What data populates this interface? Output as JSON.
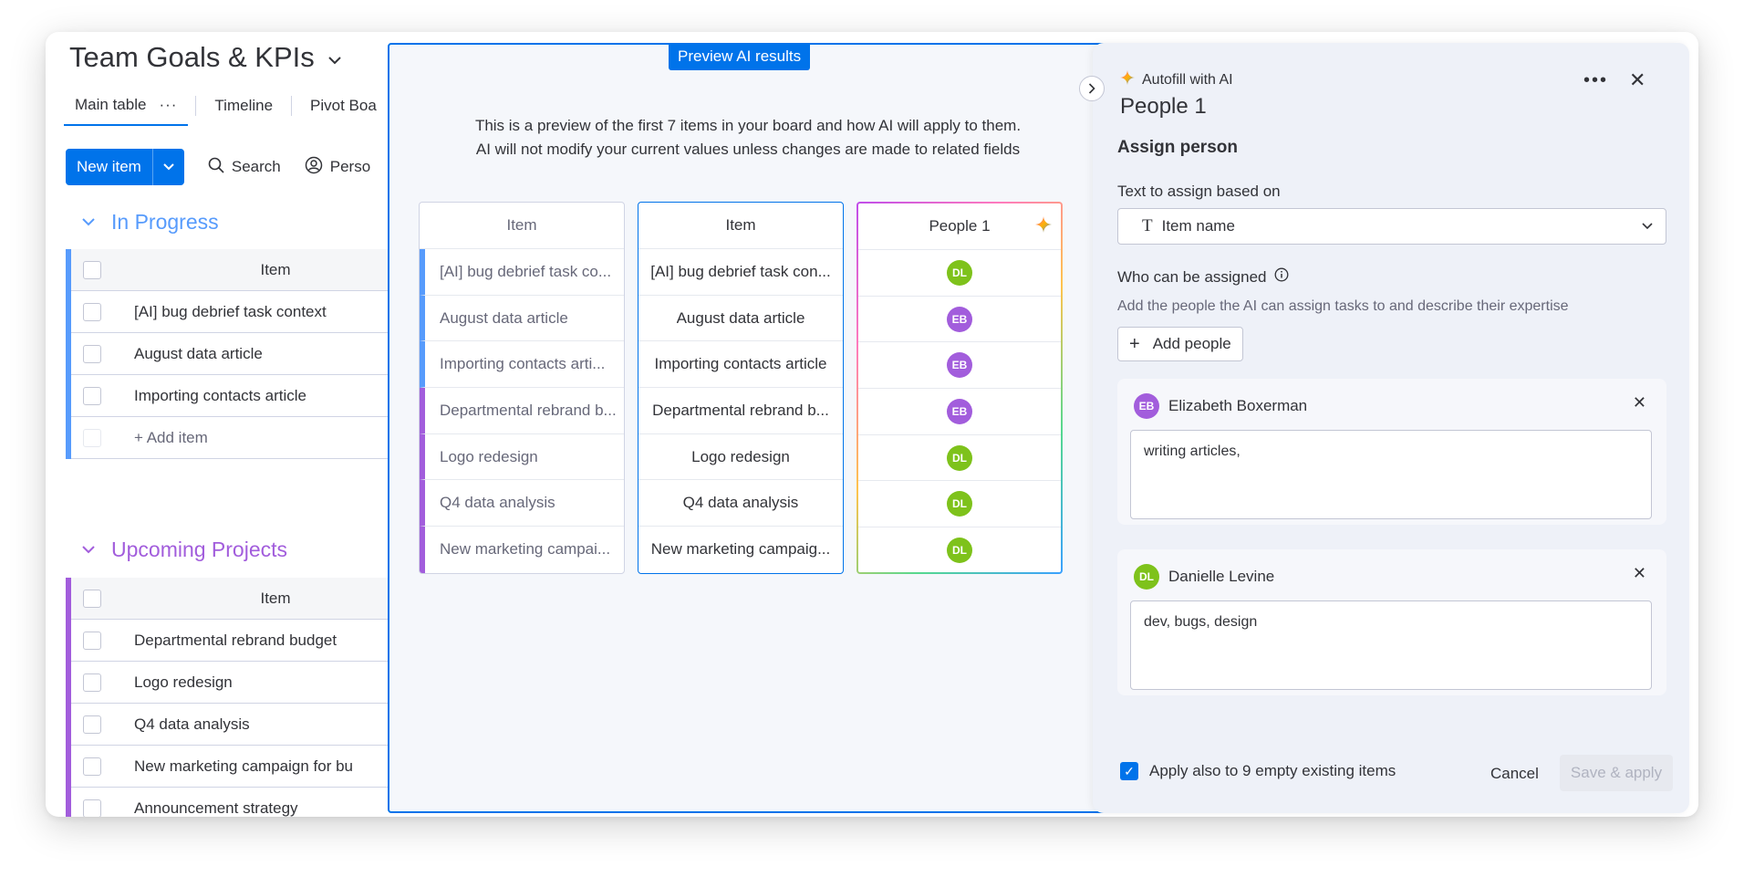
{
  "board": {
    "title": "Team Goals & KPIs",
    "tabs": [
      {
        "label": "Main table",
        "more": "···"
      },
      {
        "label": "Timeline"
      },
      {
        "label": "Pivot Boa"
      }
    ],
    "toolbar": {
      "new_item": "New item",
      "search": "Search",
      "person": "Perso"
    },
    "groups": [
      {
        "name": "In Progress",
        "color": "#579bfc",
        "column_header": "Item",
        "items": [
          "[AI] bug debrief task context",
          "August data article",
          "Importing contacts article"
        ],
        "add_item": "+ Add item"
      },
      {
        "name": "Upcoming Projects",
        "color": "#a25ddc",
        "column_header": "Item",
        "items": [
          "Departmental rebrand budget",
          "Logo redesign",
          "Q4 data analysis",
          "New marketing campaign for bu",
          "Announcement strategy"
        ]
      }
    ]
  },
  "preview": {
    "badge": "Preview AI results",
    "description_line1": "This is a preview of the first 7 items in your board and how AI will apply to them.",
    "description_line2": "AI will not modify your current values unless changes are made to related fields",
    "columns": [
      "Item",
      "Item",
      "People 1"
    ],
    "rows": [
      {
        "original": "[AI] bug debrief task co...",
        "item": "[AI] bug debrief task con...",
        "person": "DL",
        "group_color": "#579bfc"
      },
      {
        "original": "August data article",
        "item": "August data article",
        "person": "EB",
        "group_color": "#579bfc"
      },
      {
        "original": "Importing contacts arti...",
        "item": "Importing contacts article",
        "person": "EB",
        "group_color": "#579bfc"
      },
      {
        "original": "Departmental rebrand b...",
        "item": "Departmental rebrand b...",
        "person": "EB",
        "group_color": "#a25ddc"
      },
      {
        "original": "Logo redesign",
        "item": "Logo redesign",
        "person": "DL",
        "group_color": "#a25ddc"
      },
      {
        "original": "Q4 data analysis",
        "item": "Q4 data analysis",
        "person": "DL",
        "group_color": "#a25ddc"
      },
      {
        "original": "New marketing campai...",
        "item": "New marketing campaig...",
        "person": "DL",
        "group_color": "#a25ddc"
      }
    ]
  },
  "panel": {
    "brand": "Autofill with AI",
    "title": "People 1",
    "more": "•••",
    "close": "✕",
    "section": "Assign person",
    "text_label": "Text to assign based on",
    "text_value": "Item name",
    "who_label": "Who can be assigned",
    "who_sub": "Add the people the AI can assign tasks to and describe their expertise",
    "add_people": "Add people",
    "people": [
      {
        "initials": "EB",
        "name": "Elizabeth Boxerman",
        "expertise": "writing articles,",
        "color": "#a25ddc"
      },
      {
        "initials": "DL",
        "name": "Danielle Levine",
        "expertise": "dev, bugs, design",
        "color": "#7ec21b"
      }
    ],
    "apply_also": "Apply also to 9 empty existing items",
    "cancel": "Cancel",
    "save": "Save & apply"
  },
  "colors": {
    "primary": "#0073ea",
    "eb_avatar": "#a25ddc",
    "dl_avatar": "#7ec21b"
  }
}
